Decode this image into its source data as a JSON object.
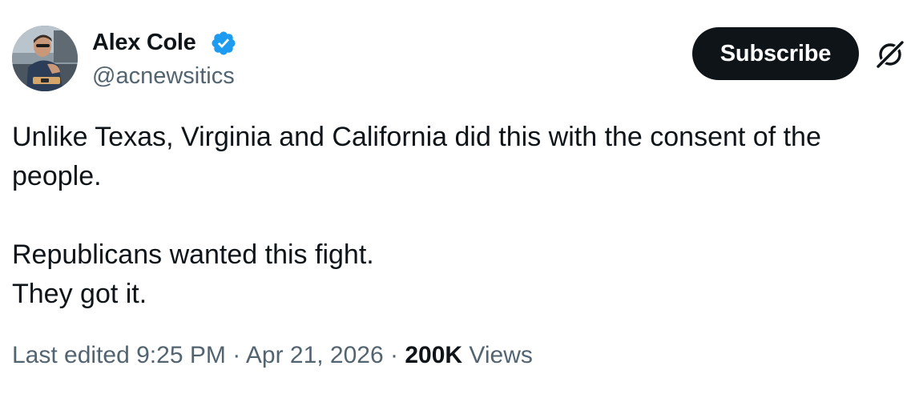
{
  "author": {
    "display_name": "Alex Cole",
    "handle": "@acnewsitics",
    "verified": true
  },
  "header": {
    "subscribe_label": "Subscribe"
  },
  "tweet": {
    "line1": "Unlike Texas, Virginia and California did this with the consent of the people.",
    "line2": "Republicans wanted this fight.",
    "line3": "They got it."
  },
  "meta": {
    "edited_label": "Last edited 9:25 PM",
    "separator": "·",
    "date": "Apr 21, 2026",
    "views_count": "200K",
    "views_label": "Views"
  },
  "colors": {
    "text_primary": "#0f1419",
    "text_secondary": "#536471",
    "verified_blue": "#1d9bf0",
    "button_bg": "#0f1419"
  },
  "icons": {
    "verified": "verified-badge-icon",
    "grok": "grok-icon"
  }
}
